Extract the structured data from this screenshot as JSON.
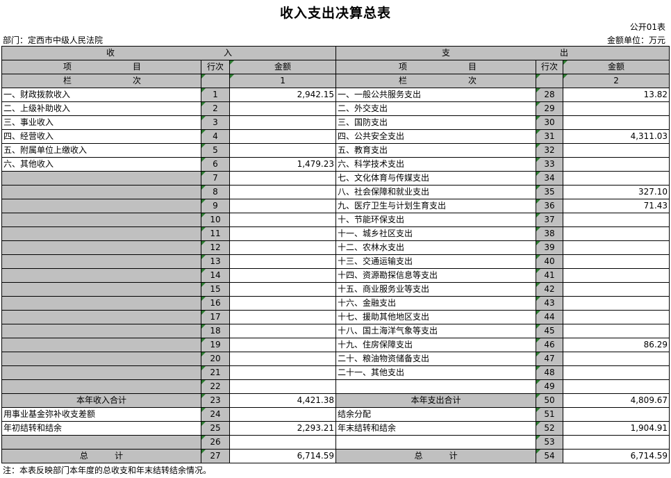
{
  "title": "收入支出决算总表",
  "form_no": "公开01表",
  "department": "部门：定西市中级人民法院",
  "unit": "金额单位：万元",
  "header": {
    "income": "收",
    "income2": "入",
    "expense": "支",
    "expense2": "出",
    "item": "项",
    "item2": "目",
    "row_no": "行次",
    "amount": "金额",
    "col": "栏",
    "col2": "次",
    "col_income": "1",
    "col_expense": "2"
  },
  "rows": [
    {
      "inc": "一、财政拨款收入",
      "inc_no": "1",
      "inc_amt": "2,942.15",
      "exp": "一、一般公共服务支出",
      "exp_no": "28",
      "exp_amt": "13.82"
    },
    {
      "inc": "二、上级补助收入",
      "inc_no": "2",
      "inc_amt": "",
      "exp": "二、外交支出",
      "exp_no": "29",
      "exp_amt": ""
    },
    {
      "inc": "三、事业收入",
      "inc_no": "3",
      "inc_amt": "",
      "exp": "三、国防支出",
      "exp_no": "30",
      "exp_amt": ""
    },
    {
      "inc": "四、经营收入",
      "inc_no": "4",
      "inc_amt": "",
      "exp": "四、公共安全支出",
      "exp_no": "31",
      "exp_amt": "4,311.03"
    },
    {
      "inc": "五、附属单位上缴收入",
      "inc_no": "5",
      "inc_amt": "",
      "exp": "五、教育支出",
      "exp_no": "32",
      "exp_amt": ""
    },
    {
      "inc": "六、其他收入",
      "inc_no": "6",
      "inc_amt": "1,479.23",
      "exp": "六、科学技术支出",
      "exp_no": "33",
      "exp_amt": ""
    },
    {
      "inc": "",
      "inc_no": "7",
      "inc_amt": "",
      "exp": "七、文化体育与传媒支出",
      "exp_no": "34",
      "exp_amt": ""
    },
    {
      "inc": "",
      "inc_no": "8",
      "inc_amt": "",
      "exp": "八、社会保障和就业支出",
      "exp_no": "35",
      "exp_amt": "327.10"
    },
    {
      "inc": "",
      "inc_no": "9",
      "inc_amt": "",
      "exp": "九、医疗卫生与计划生育支出",
      "exp_no": "36",
      "exp_amt": "71.43"
    },
    {
      "inc": "",
      "inc_no": "10",
      "inc_amt": "",
      "exp": "十、节能环保支出",
      "exp_no": "37",
      "exp_amt": ""
    },
    {
      "inc": "",
      "inc_no": "11",
      "inc_amt": "",
      "exp": "十一、城乡社区支出",
      "exp_no": "38",
      "exp_amt": ""
    },
    {
      "inc": "",
      "inc_no": "12",
      "inc_amt": "",
      "exp": "十二、农林水支出",
      "exp_no": "39",
      "exp_amt": ""
    },
    {
      "inc": "",
      "inc_no": "13",
      "inc_amt": "",
      "exp": "十三、交通运输支出",
      "exp_no": "40",
      "exp_amt": ""
    },
    {
      "inc": "",
      "inc_no": "14",
      "inc_amt": "",
      "exp": "十四、资源勘探信息等支出",
      "exp_no": "41",
      "exp_amt": ""
    },
    {
      "inc": "",
      "inc_no": "15",
      "inc_amt": "",
      "exp": "十五、商业服务业等支出",
      "exp_no": "42",
      "exp_amt": ""
    },
    {
      "inc": "",
      "inc_no": "16",
      "inc_amt": "",
      "exp": "十六、金融支出",
      "exp_no": "43",
      "exp_amt": ""
    },
    {
      "inc": "",
      "inc_no": "17",
      "inc_amt": "",
      "exp": "十七、援助其他地区支出",
      "exp_no": "44",
      "exp_amt": ""
    },
    {
      "inc": "",
      "inc_no": "18",
      "inc_amt": "",
      "exp": "十八、国土海洋气象等支出",
      "exp_no": "45",
      "exp_amt": ""
    },
    {
      "inc": "",
      "inc_no": "19",
      "inc_amt": "",
      "exp": "十九、住房保障支出",
      "exp_no": "46",
      "exp_amt": "86.29"
    },
    {
      "inc": "",
      "inc_no": "20",
      "inc_amt": "",
      "exp": "二十、粮油物资储备支出",
      "exp_no": "47",
      "exp_amt": ""
    },
    {
      "inc": "",
      "inc_no": "21",
      "inc_amt": "",
      "exp": "二十一、其他支出",
      "exp_no": "48",
      "exp_amt": ""
    },
    {
      "inc": "",
      "inc_no": "22",
      "inc_amt": "",
      "exp": "",
      "exp_no": "49",
      "exp_amt": ""
    },
    {
      "inc": "本年收入合计",
      "inc_no": "23",
      "inc_amt": "4,421.38",
      "exp": "本年支出合计",
      "exp_no": "50",
      "exp_amt": "4,809.67",
      "center": true,
      "gray_label": true
    },
    {
      "inc": "用事业基金弥补收支差额",
      "inc_no": "24",
      "inc_amt": "",
      "exp": "结余分配",
      "exp_no": "51",
      "exp_amt": ""
    },
    {
      "inc": "年初结转和结余",
      "inc_no": "25",
      "inc_amt": "2,293.21",
      "exp": "年末结转和结余",
      "exp_no": "52",
      "exp_amt": "1,904.91"
    },
    {
      "inc": "",
      "inc_no": "26",
      "inc_amt": "",
      "exp": "",
      "exp_no": "53",
      "exp_amt": ""
    },
    {
      "inc": "总          计",
      "inc_no": "27",
      "inc_amt": "6,714.59",
      "exp": "总          计",
      "exp_no": "54",
      "exp_amt": "6,714.59",
      "center": true,
      "gray_label": true
    }
  ],
  "note": "注：本表反映部门本年度的总收支和年末结转结余情况。"
}
